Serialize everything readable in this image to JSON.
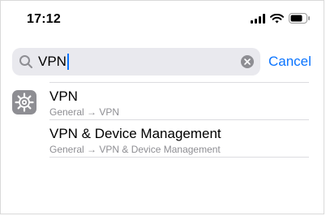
{
  "status_bar": {
    "time": "17:12",
    "icons": [
      "cellular-signal-icon",
      "wifi-icon",
      "battery-icon"
    ]
  },
  "search": {
    "query": "VPN",
    "cancel_label": "Cancel",
    "accent_color": "#0a74ff"
  },
  "results": [
    {
      "title": "VPN",
      "path": "General → VPN",
      "icon": "gear-icon"
    },
    {
      "title": "VPN & Device Management",
      "path": "General → VPN & Device Management"
    }
  ]
}
